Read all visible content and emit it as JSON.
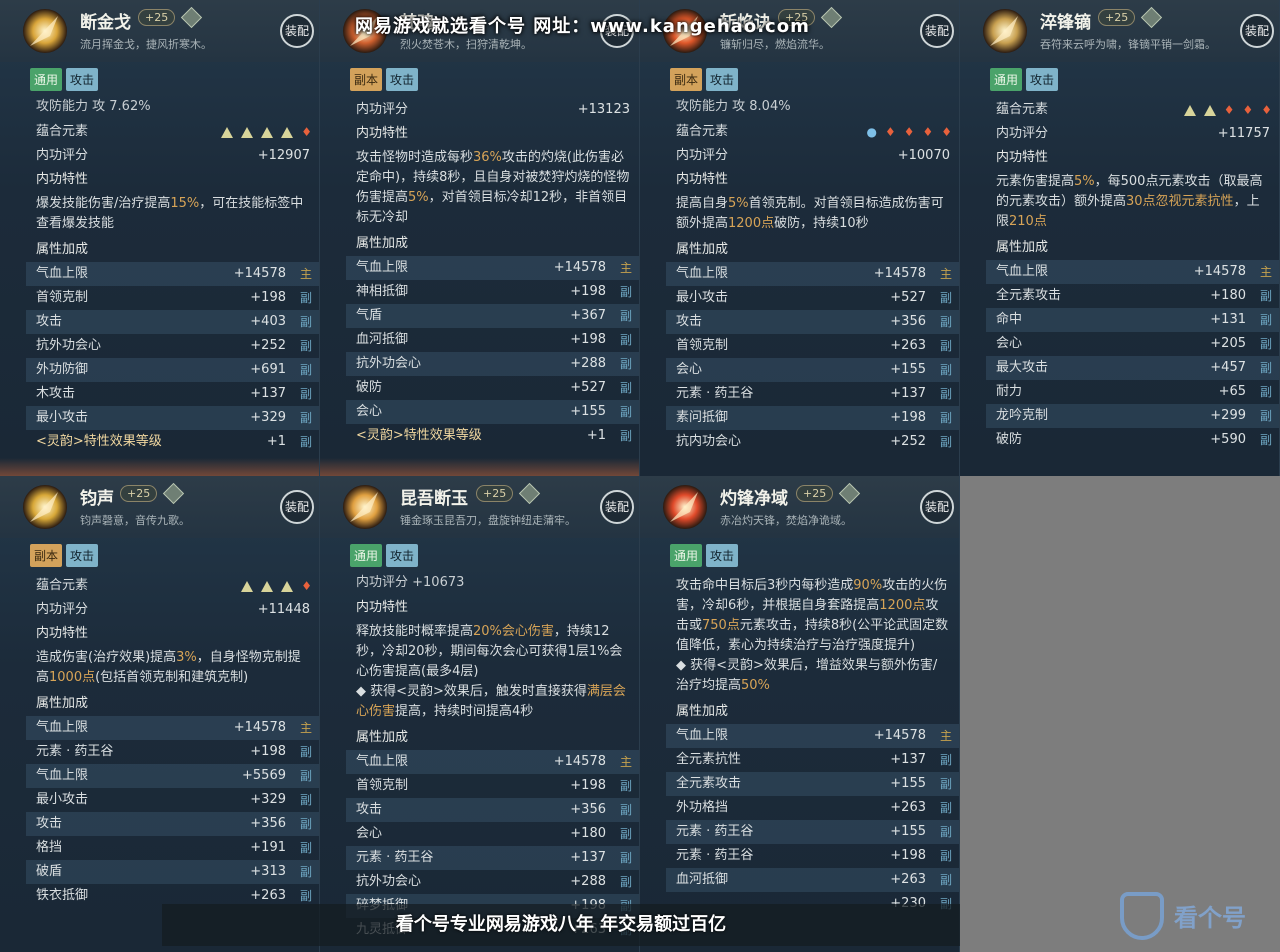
{
  "watermark": {
    "top": "网易游戏就选看个号   网址：www.kangehao.com",
    "bottom": "看个号专业网易游戏八年  年交易额过百亿",
    "logo": "看个号"
  },
  "cards": [
    {
      "name": "断金戈",
      "level": "+25",
      "tagline": "流月挥金戈，捷风折寒木。",
      "equip": "装配",
      "icon_color": "#d9a53a",
      "tags": [
        {
          "label": "通用",
          "style": "green"
        },
        {
          "label": "攻击",
          "style": "blue"
        }
      ],
      "partial_top": "攻防能力                  攻 7.62%",
      "element_label": "蕴合元素",
      "elements": [
        "tri",
        "tri",
        "tri",
        "tri",
        "fire"
      ],
      "score_label": "内功评分",
      "score": "+12907",
      "trait_label": "内功特性",
      "desc": [
        {
          "t": "爆发技能伤害/治疗提高"
        },
        {
          "t": "15%",
          "h": true
        },
        {
          "t": "，可在技能标签中查看爆发技能"
        }
      ],
      "attr_label": "属性加成",
      "attrs": [
        {
          "k": "气血上限",
          "v": "+14578",
          "m": "主"
        },
        {
          "k": "首领克制",
          "v": "+198",
          "m": "副"
        },
        {
          "k": "攻击",
          "v": "+403",
          "m": "副"
        },
        {
          "k": "抗外功会心",
          "v": "+252",
          "m": "副"
        },
        {
          "k": "外功防御",
          "v": "+691",
          "m": "副"
        },
        {
          "k": "木攻击",
          "v": "+137",
          "m": "副"
        },
        {
          "k": "最小攻击",
          "v": "+329",
          "m": "副"
        },
        {
          "k": "<灵韵>特性效果等级",
          "v": "+1",
          "m": "副",
          "special": true
        }
      ]
    },
    {
      "name": "梵魂",
      "level": "",
      "tagline": "烈火焚苍木，扫狩清乾坤。",
      "equip": "装配",
      "icon_color": "#d0612f",
      "tags": [
        {
          "label": "副本",
          "style": "orange"
        },
        {
          "label": "攻击",
          "style": "blue"
        }
      ],
      "partial_top": "",
      "element_label": "",
      "elements": [],
      "score_label": "内功评分",
      "score": "+13123",
      "trait_label": "内功特性",
      "desc": [
        {
          "t": "攻击怪物时造成每秒"
        },
        {
          "t": "36%",
          "h": true
        },
        {
          "t": "攻击的灼烧(此伤害必定命中)，持续8秒，且自身对被焚狩灼烧的怪物伤害提高"
        },
        {
          "t": "5%",
          "h": true
        },
        {
          "t": "，对首领目标冷却12秒，非首领目标无冷却"
        }
      ],
      "attr_label": "属性加成",
      "attrs": [
        {
          "k": "气血上限",
          "v": "+14578",
          "m": "主"
        },
        {
          "k": "神相抵御",
          "v": "+198",
          "m": "副"
        },
        {
          "k": "气盾",
          "v": "+367",
          "m": "副"
        },
        {
          "k": "血河抵御",
          "v": "+198",
          "m": "副"
        },
        {
          "k": "抗外功会心",
          "v": "+288",
          "m": "副"
        },
        {
          "k": "破防",
          "v": "+527",
          "m": "副"
        },
        {
          "k": "会心",
          "v": "+155",
          "m": "副"
        },
        {
          "k": "<灵韵>特性效果等级",
          "v": "+1",
          "m": "副",
          "special": true
        }
      ]
    },
    {
      "name": "斩焰诀",
      "level": "+25",
      "tagline": "镰斩归尽，燃焰流华。",
      "equip": "装配",
      "icon_color": "#e0582a",
      "tags": [
        {
          "label": "副本",
          "style": "orange"
        },
        {
          "label": "攻击",
          "style": "blue"
        }
      ],
      "partial_top": "攻防能力                  攻 8.04%",
      "element_label": "蕴合元素",
      "elements": [
        "drop",
        "fire",
        "fire",
        "fire",
        "fire"
      ],
      "score_label": "内功评分",
      "score": "+10070",
      "trait_label": "内功特性",
      "desc": [
        {
          "t": "提高自身"
        },
        {
          "t": "5%",
          "h": true
        },
        {
          "t": "首领克制。对首领目标造成伤害可额外提高"
        },
        {
          "t": "1200点",
          "h": true
        },
        {
          "t": "破防，持续10秒"
        }
      ],
      "attr_label": "属性加成",
      "attrs": [
        {
          "k": "气血上限",
          "v": "+14578",
          "m": "主"
        },
        {
          "k": "最小攻击",
          "v": "+527",
          "m": "副"
        },
        {
          "k": "攻击",
          "v": "+356",
          "m": "副"
        },
        {
          "k": "首领克制",
          "v": "+263",
          "m": "副"
        },
        {
          "k": "会心",
          "v": "+155",
          "m": "副"
        },
        {
          "k": "元素 · 药王谷",
          "v": "+137",
          "m": "副"
        },
        {
          "k": "素问抵御",
          "v": "+198",
          "m": "副"
        },
        {
          "k": "抗内功会心",
          "v": "+252",
          "m": "副"
        }
      ]
    },
    {
      "name": "淬锋镝",
      "level": "+25",
      "tagline": "吞符来云呼为啸，锋镝平销一剑霜。",
      "equip": "装配",
      "icon_color": "#c8a050",
      "tags": [
        {
          "label": "通用",
          "style": "green"
        },
        {
          "label": "攻击",
          "style": "blue"
        }
      ],
      "partial_top": "",
      "element_label": "蕴合元素",
      "elements": [
        "tri",
        "tri",
        "fire",
        "fire",
        "fire"
      ],
      "score_label": "内功评分",
      "score": "+11757",
      "trait_label": "内功特性",
      "desc": [
        {
          "t": "元素伤害提高"
        },
        {
          "t": "5%",
          "h": true
        },
        {
          "t": "，每500点元素攻击（取最高的元素攻击）额外提高"
        },
        {
          "t": "30点忽视元素抗性",
          "h": true
        },
        {
          "t": "，上限"
        },
        {
          "t": "210点",
          "h": true
        }
      ],
      "attr_label": "属性加成",
      "attrs": [
        {
          "k": "气血上限",
          "v": "+14578",
          "m": "主"
        },
        {
          "k": "全元素攻击",
          "v": "+180",
          "m": "副"
        },
        {
          "k": "命中",
          "v": "+131",
          "m": "副"
        },
        {
          "k": "会心",
          "v": "+205",
          "m": "副"
        },
        {
          "k": "最大攻击",
          "v": "+457",
          "m": "副"
        },
        {
          "k": "耐力",
          "v": "+65",
          "m": "副"
        },
        {
          "k": "龙吟克制",
          "v": "+299",
          "m": "副"
        },
        {
          "k": "破防",
          "v": "+590",
          "m": "副"
        }
      ]
    },
    {
      "name": "钧声",
      "level": "+25",
      "tagline": "钧声磬意，音传九歌。",
      "equip": "装配",
      "icon_color": "#d8a838",
      "tags": [
        {
          "label": "副本",
          "style": "orange"
        },
        {
          "label": "攻击",
          "style": "blue"
        }
      ],
      "partial_top": "",
      "element_label": "蕴合元素",
      "elements": [
        "tri",
        "tri",
        "tri",
        "fire"
      ],
      "score_label": "内功评分",
      "score": "+11448",
      "trait_label": "内功特性",
      "desc": [
        {
          "t": "造成伤害(治疗效果)提高"
        },
        {
          "t": "3%",
          "h": true
        },
        {
          "t": "，自身怪物克制提高"
        },
        {
          "t": "1000点",
          "h": true
        },
        {
          "t": "(包括首领克制和建筑克制)"
        }
      ],
      "attr_label": "属性加成",
      "attrs": [
        {
          "k": "气血上限",
          "v": "+14578",
          "m": "主"
        },
        {
          "k": "元素 · 药王谷",
          "v": "+198",
          "m": "副"
        },
        {
          "k": "气血上限",
          "v": "+5569",
          "m": "副"
        },
        {
          "k": "最小攻击",
          "v": "+329",
          "m": "副"
        },
        {
          "k": "攻击",
          "v": "+356",
          "m": "副"
        },
        {
          "k": "格挡",
          "v": "+191",
          "m": "副"
        },
        {
          "k": "破盾",
          "v": "+313",
          "m": "副"
        },
        {
          "k": "铁衣抵御",
          "v": "+263",
          "m": "副"
        }
      ]
    },
    {
      "name": "昆吾断玉",
      "level": "+25",
      "tagline": "锤金琢玉昆吾刀，盘旋钟纽走蒲牢。",
      "equip": "装配",
      "icon_color": "#e0a040",
      "tags": [
        {
          "label": "通用",
          "style": "green"
        },
        {
          "label": "攻击",
          "style": "blue"
        }
      ],
      "partial_top": "内功评分                           +10673",
      "element_label": "",
      "elements": [],
      "score_label": "",
      "score": "",
      "trait_label": "内功特性",
      "desc": [
        {
          "t": "释放技能时概率提高"
        },
        {
          "t": "20%会心伤害",
          "h": true
        },
        {
          "t": "，持续12秒，冷却20秒，期间每次会心可获得1层1%会心伤害提高(最多4层)"
        },
        {
          "br": true
        },
        {
          "t": "◆ 获得<灵韵>效果后，触发时直接获得"
        },
        {
          "t": "满层会心伤害",
          "h": true
        },
        {
          "t": "提高，持续时间提高4秒"
        }
      ],
      "attr_label": "属性加成",
      "attrs": [
        {
          "k": "气血上限",
          "v": "+14578",
          "m": "主"
        },
        {
          "k": "首领克制",
          "v": "+198",
          "m": "副"
        },
        {
          "k": "攻击",
          "v": "+356",
          "m": "副"
        },
        {
          "k": "会心",
          "v": "+180",
          "m": "副"
        },
        {
          "k": "元素 · 药王谷",
          "v": "+137",
          "m": "副"
        },
        {
          "k": "抗外功会心",
          "v": "+288",
          "m": "副"
        },
        {
          "k": "碎梦抵御",
          "v": "+198",
          "m": "副"
        },
        {
          "k": "九灵抵御",
          "v": "+263",
          "m": "副"
        }
      ]
    },
    {
      "name": "灼锋净域",
      "level": "+25",
      "tagline": "赤冶灼天锋，焚焰净诡域。",
      "equip": "装配",
      "icon_color": "#e04a2a",
      "tags": [
        {
          "label": "通用",
          "style": "green"
        },
        {
          "label": "攻击",
          "style": "blue"
        }
      ],
      "partial_top": "",
      "element_label": "",
      "elements": [],
      "score_label": "",
      "score": "",
      "trait_label": "",
      "desc": [
        {
          "t": "攻击命中目标后3秒内每秒造成"
        },
        {
          "t": "90%",
          "h": true
        },
        {
          "t": "攻击的火伤害，冷却6秒，并根据自身套路提高"
        },
        {
          "t": "1200点",
          "h": true
        },
        {
          "t": "攻击或"
        },
        {
          "t": "750点",
          "h": true
        },
        {
          "t": "元素攻击，持续8秒(公平论武固定数值降低，素心为持续治疗与治疗强度提升)"
        },
        {
          "br": true
        },
        {
          "t": "◆ 获得<灵韵>效果后，增益效果与额外伤害/治疗均提高"
        },
        {
          "t": "50%",
          "h": true
        }
      ],
      "attr_label": "属性加成",
      "attrs": [
        {
          "k": "气血上限",
          "v": "+14578",
          "m": "主"
        },
        {
          "k": "全元素抗性",
          "v": "+137",
          "m": "副"
        },
        {
          "k": "全元素攻击",
          "v": "+155",
          "m": "副"
        },
        {
          "k": "外功格挡",
          "v": "+263",
          "m": "副"
        },
        {
          "k": "元素 · 药王谷",
          "v": "+155",
          "m": "副"
        },
        {
          "k": "元素 · 药王谷",
          "v": "+198",
          "m": "副"
        },
        {
          "k": "血河抵御",
          "v": "+263",
          "m": "副"
        },
        {
          "k": "",
          "v": "+230",
          "m": "副"
        }
      ]
    }
  ]
}
